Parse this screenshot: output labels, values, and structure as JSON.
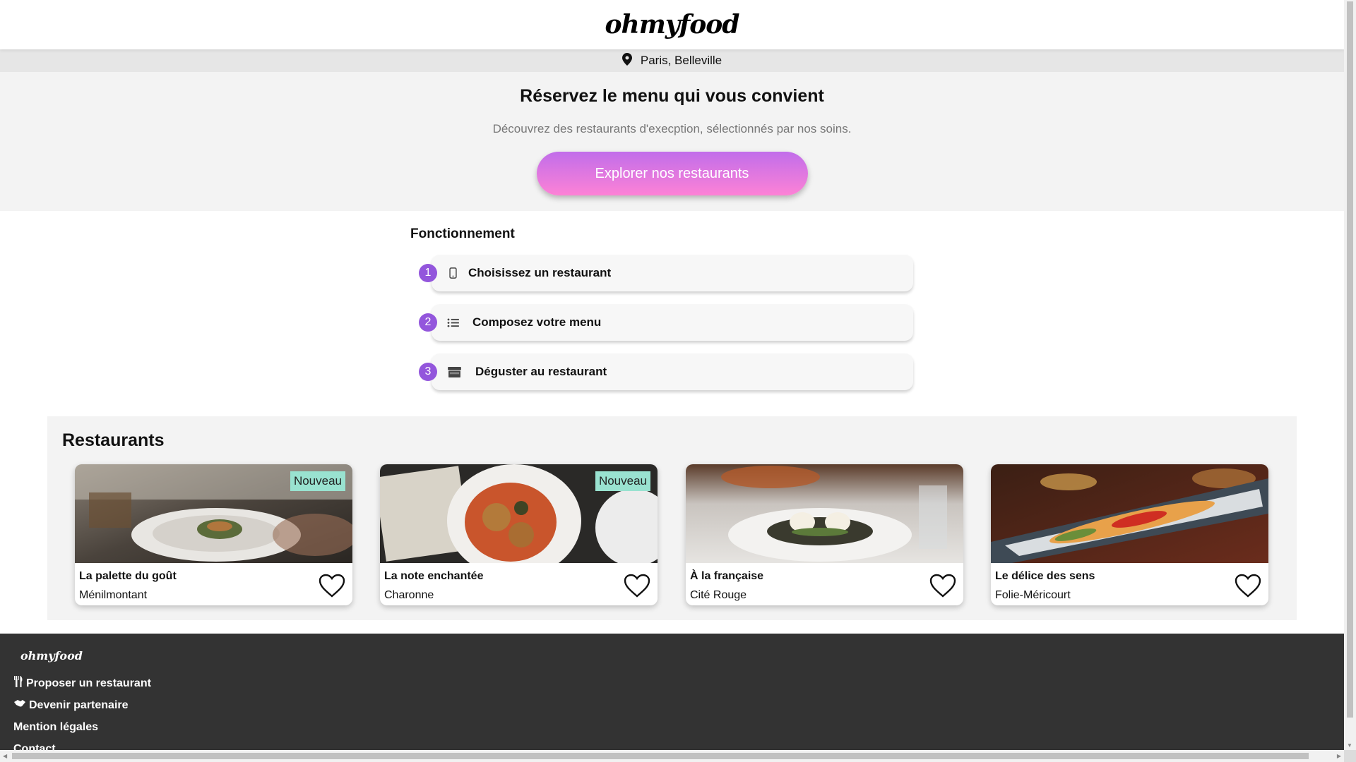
{
  "header": {
    "logo": "ohmyfood"
  },
  "location": {
    "text": "Paris, Belleville",
    "icon": "map-pin-icon"
  },
  "hero": {
    "title": "Réservez le menu qui vous convient",
    "subtitle": "Découvrez des restaurants d'execption, sélectionnés par nos soins.",
    "cta": "Explorer nos restaurants"
  },
  "how": {
    "title": "Fonctionnement",
    "steps": [
      {
        "num": "1",
        "label": "Choisissez un restaurant",
        "icon": "mobile-phone-icon"
      },
      {
        "num": "2",
        "label": "Composez votre menu",
        "icon": "list-icon"
      },
      {
        "num": "3",
        "label": "Déguster au restaurant",
        "icon": "store-icon"
      }
    ]
  },
  "restaurants": {
    "title": "Restaurants",
    "items": [
      {
        "name": "La palette du goût",
        "area": "Ménilmontant",
        "badge": "Nouveau"
      },
      {
        "name": "La note enchantée",
        "area": "Charonne",
        "badge": "Nouveau"
      },
      {
        "name": "À la française",
        "area": "Cité Rouge",
        "badge": ""
      },
      {
        "name": "Le délice des sens",
        "area": "Folie-Méricourt",
        "badge": ""
      }
    ]
  },
  "footer": {
    "logo": "ohmyfood",
    "links": [
      {
        "label": "Proposer un restaurant",
        "icon": "utensils-icon"
      },
      {
        "label": "Devenir partenaire",
        "icon": "handshake-icon"
      },
      {
        "label": "Mention légales"
      },
      {
        "label": "Contact"
      }
    ]
  },
  "colors": {
    "accent_purple": "#9356dc",
    "cta_gradient_top": "#c16dea",
    "cta_gradient_bottom": "#fd82d6",
    "badge_green": "#99e2d0",
    "footer_bg": "#333333"
  }
}
